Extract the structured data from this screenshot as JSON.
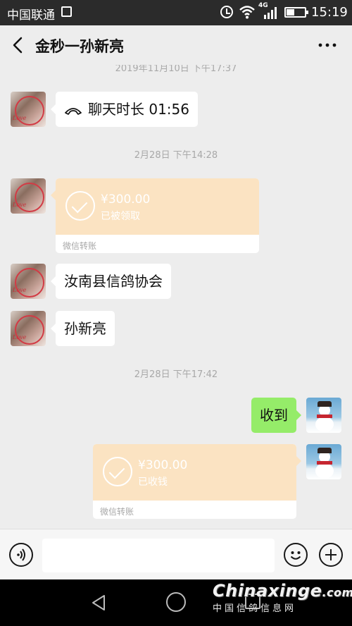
{
  "status_bar": {
    "carrier": "中国联通",
    "network": "4G",
    "time": "15:19"
  },
  "header": {
    "title": "金秒一孙新亮"
  },
  "chat": {
    "timestamp_partial": "2019年11月10日 下午17:37",
    "messages": [
      {
        "type": "call",
        "direction": "in",
        "text": "聊天时长 01:56"
      },
      {
        "type": "timestamp",
        "text": "2月28日 下午14:28"
      },
      {
        "type": "transfer",
        "direction": "in",
        "amount": "¥300.00",
        "state": "已被领取",
        "label": "微信转账"
      },
      {
        "type": "text",
        "direction": "in",
        "text": "汝南县信鸽协会"
      },
      {
        "type": "text",
        "direction": "in",
        "text": "孙新亮"
      },
      {
        "type": "timestamp",
        "text": "2月28日 下午17:42"
      },
      {
        "type": "text",
        "direction": "out",
        "text": "收到"
      },
      {
        "type": "transfer",
        "direction": "out",
        "amount": "¥300.00",
        "state": "已收钱",
        "label": "微信转账"
      }
    ]
  },
  "watermark": {
    "main": "Chinaxinge",
    "suffix": ".com",
    "sub": "中国信鸽信息网"
  },
  "colors": {
    "status_bar_bg": "#2b2b2b",
    "chat_bg": "#ededed",
    "outgoing_bubble": "#95ec69",
    "transfer_card": "#fbe3c2",
    "nav_bar_bg": "#000000"
  },
  "icons": [
    "back-arrow-icon",
    "more-icon",
    "phone-icon",
    "check-circle-icon",
    "voice-icon",
    "emoji-icon",
    "plus-icon",
    "nav-back-icon",
    "nav-home-icon",
    "nav-recent-icon",
    "wifi-icon",
    "signal-icon",
    "battery-icon",
    "alarm-icon"
  ]
}
